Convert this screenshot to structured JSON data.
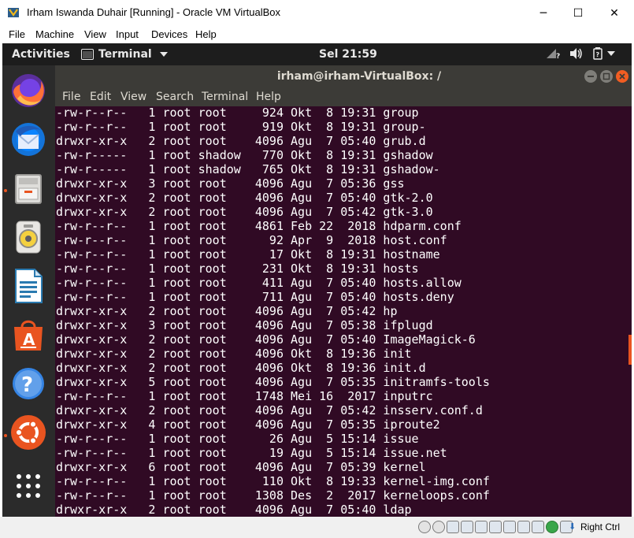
{
  "window": {
    "title": "Irham Iswanda Duhair [Running] - Oracle VM VirtualBox",
    "controls": {
      "minimize": "─",
      "maximize": "☐",
      "close": "✕"
    }
  },
  "menubar": [
    "File",
    "Machine",
    "View",
    "Input",
    "Devices",
    "Help"
  ],
  "gnome": {
    "activities": "Activities",
    "app_menu": "Terminal",
    "clock": "Sel 21:59"
  },
  "dock": {
    "items": [
      "firefox-icon",
      "thunderbird-icon",
      "files-icon",
      "rhythmbox-icon",
      "libreoffice-writer-icon",
      "software-center-icon",
      "help-icon",
      "ubuntu-icon",
      "show-apps-icon"
    ]
  },
  "terminal": {
    "title": "irham@irham-VirtualBox: /",
    "menu": [
      "File",
      "Edit",
      "View",
      "Search",
      "Terminal",
      "Help"
    ],
    "lines": [
      "-rw-r--r--   1 root root     924 Okt  8 19:31 group",
      "-rw-r--r--   1 root root     919 Okt  8 19:31 group-",
      "drwxr-xr-x   2 root root    4096 Agu  7 05:40 grub.d",
      "-rw-r-----   1 root shadow   770 Okt  8 19:31 gshadow",
      "-rw-r-----   1 root shadow   765 Okt  8 19:31 gshadow-",
      "drwxr-xr-x   3 root root    4096 Agu  7 05:36 gss",
      "drwxr-xr-x   2 root root    4096 Agu  7 05:40 gtk-2.0",
      "drwxr-xr-x   2 root root    4096 Agu  7 05:42 gtk-3.0",
      "-rw-r--r--   1 root root    4861 Feb 22  2018 hdparm.conf",
      "-rw-r--r--   1 root root      92 Apr  9  2018 host.conf",
      "-rw-r--r--   1 root root      17 Okt  8 19:31 hostname",
      "-rw-r--r--   1 root root     231 Okt  8 19:31 hosts",
      "-rw-r--r--   1 root root     411 Agu  7 05:40 hosts.allow",
      "-rw-r--r--   1 root root     711 Agu  7 05:40 hosts.deny",
      "drwxr-xr-x   2 root root    4096 Agu  7 05:42 hp",
      "drwxr-xr-x   3 root root    4096 Agu  7 05:38 ifplugd",
      "drwxr-xr-x   2 root root    4096 Agu  7 05:40 ImageMagick-6",
      "drwxr-xr-x   2 root root    4096 Okt  8 19:36 init",
      "drwxr-xr-x   2 root root    4096 Okt  8 19:36 init.d",
      "drwxr-xr-x   5 root root    4096 Agu  7 05:35 initramfs-tools",
      "-rw-r--r--   1 root root    1748 Mei 16  2017 inputrc",
      "drwxr-xr-x   2 root root    4096 Agu  7 05:42 insserv.conf.d",
      "drwxr-xr-x   4 root root    4096 Agu  7 05:35 iproute2",
      "-rw-r--r--   1 root root      26 Agu  5 15:14 issue",
      "-rw-r--r--   1 root root      19 Agu  5 15:14 issue.net",
      "drwxr-xr-x   6 root root    4096 Agu  7 05:39 kernel",
      "-rw-r--r--   1 root root     110 Okt  8 19:33 kernel-img.conf",
      "-rw-r--r--   1 root root    1308 Des  2  2017 kerneloops.conf",
      "drwxr-xr-x   2 root root    4096 Agu  7 05:40 ldap"
    ]
  },
  "statusbar": {
    "host_key": "Right Ctrl"
  },
  "colors": {
    "terminal_bg": "#300a24",
    "terminal_fg": "#ffffff",
    "ubuntu_orange": "#e95420",
    "dock_bg": "#2b2b2b",
    "topbar_bg": "#1d1d1d"
  }
}
